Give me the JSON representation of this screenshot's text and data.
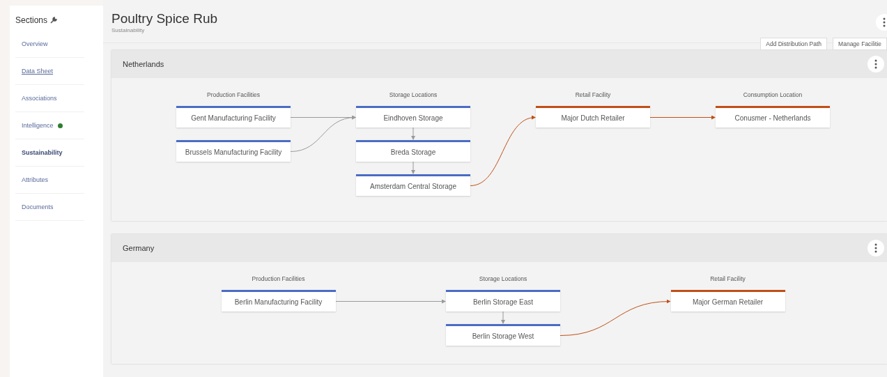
{
  "sidebar": {
    "title": "Sections",
    "items": [
      {
        "label": "Overview",
        "selected": false,
        "underlined": false
      },
      {
        "label": "Data Sheet",
        "selected": false,
        "underlined": true
      },
      {
        "label": "Associations",
        "selected": false,
        "underlined": false
      },
      {
        "label": "Intelligence",
        "selected": false,
        "underlined": false,
        "color": "#2e7d32"
      },
      {
        "label": "Sustainability",
        "selected": true,
        "underlined": false
      },
      {
        "label": "Attributes",
        "selected": false,
        "underlined": false
      },
      {
        "label": "Documents",
        "selected": false,
        "underlined": false
      }
    ]
  },
  "header": {
    "title": "Poultry Spice Rub",
    "subtitle": "Sustainability"
  },
  "buttons": [
    "Add Distribution Path",
    "Manage Facilitie"
  ],
  "regions": [
    {
      "name": "Netherlands",
      "columns": [
        {
          "title": "Production Facilities",
          "color": "#4a6cc4",
          "nodes": [
            "Gent Manufacturing Facility",
            "Brussels Manufacturing Facility"
          ]
        },
        {
          "title": "Storage Locations",
          "color": "#4a6cc4",
          "nodes": [
            "Eindhoven Storage",
            "Breda Storage",
            "Amsterdam Central Storage"
          ]
        },
        {
          "title": "Retail Facility",
          "color": "#c04f16",
          "nodes": [
            "Major Dutch Retailer"
          ]
        },
        {
          "title": "Consumption Location",
          "color": "#c04f16",
          "nodes": [
            "Conusmer - Netherlands"
          ]
        }
      ]
    },
    {
      "name": "Germany",
      "columns": [
        {
          "title": "Production Facilities",
          "color": "#4a6cc4",
          "nodes": [
            "Berlin Manufacturing Facility"
          ]
        },
        {
          "title": "Storage Locations",
          "color": "#4a6cc4",
          "nodes": [
            "Berlin Storage East",
            "Berlin Storage West"
          ]
        },
        {
          "title": "Retail Facility",
          "color": "#c04f16",
          "nodes": [
            "Major German Retailer"
          ]
        }
      ]
    }
  ]
}
